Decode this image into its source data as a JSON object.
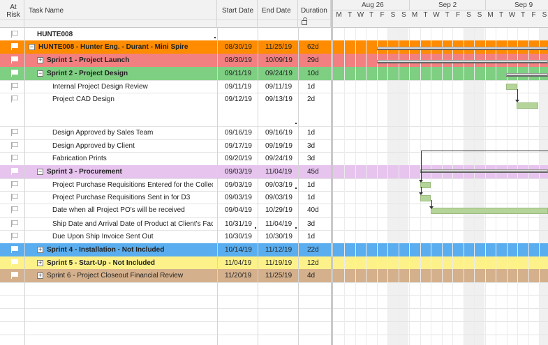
{
  "columns": {
    "at_risk": "At Risk",
    "task_name": "Task Name",
    "start_date": "Start Date",
    "end_date": "End Date",
    "duration": "Duration"
  },
  "timeline": {
    "weeks": [
      "Aug 26",
      "Sep 2",
      "Sep 9"
    ],
    "days": [
      "M",
      "T",
      "W",
      "T",
      "F",
      "S",
      "S",
      "M",
      "T",
      "W",
      "T",
      "F",
      "S",
      "S",
      "M",
      "T",
      "W",
      "T",
      "F",
      "S"
    ]
  },
  "rows": [
    {
      "name": "HUNTE008",
      "start": "",
      "end": "",
      "duration": "",
      "bold": true
    },
    {
      "name": "HUNTE008 - Hunter Eng. - Durant - Mini Spire",
      "start": "08/30/19",
      "end": "11/25/19",
      "duration": "62d",
      "bold": true,
      "toggle": "−",
      "color": "#ff8c00"
    },
    {
      "name": "Sprint 1 - Project Launch",
      "start": "08/30/19",
      "end": "10/09/19",
      "duration": "29d",
      "bold": true,
      "toggle": "+",
      "color": "#f28080"
    },
    {
      "name": "Sprint 2 - Project Design",
      "start": "09/11/19",
      "end": "09/24/19",
      "duration": "10d",
      "bold": true,
      "toggle": "−",
      "color": "#7ecf82"
    },
    {
      "name": "Internal Project Design Review",
      "start": "09/11/19",
      "end": "09/11/19",
      "duration": "1d"
    },
    {
      "name": "Project CAD Design",
      "start": "09/12/19",
      "end": "09/13/19",
      "duration": "2d"
    },
    {
      "name": "Design Approved by Sales Team",
      "start": "09/16/19",
      "end": "09/16/19",
      "duration": "1d"
    },
    {
      "name": "Design Approved by Client",
      "start": "09/17/19",
      "end": "09/19/19",
      "duration": "3d"
    },
    {
      "name": "Fabrication Prints",
      "start": "09/20/19",
      "end": "09/24/19",
      "duration": "3d"
    },
    {
      "name": "Sprint 3 - Procurement",
      "start": "09/03/19",
      "end": "11/04/19",
      "duration": "45d",
      "bold": true,
      "toggle": "−",
      "color": "#e6c4ee"
    },
    {
      "name": "Project Purchase Requisitions Entered for the Collector",
      "start": "09/03/19",
      "end": "09/03/19",
      "duration": "1d"
    },
    {
      "name": "Project Purchase Requisitions Sent in for D3",
      "start": "09/03/19",
      "end": "09/03/19",
      "duration": "1d"
    },
    {
      "name": "Date when all Project PO's will be received",
      "start": "09/04/19",
      "end": "10/29/19",
      "duration": "40d"
    },
    {
      "name": "Ship Date and Arrival Date of Product at Client's Facility",
      "start": "10/31/19",
      "end": "11/04/19",
      "duration": "3d"
    },
    {
      "name": "Due Upon Ship Invoice Sent Out",
      "start": "10/30/19",
      "end": "10/30/19",
      "duration": "1d"
    },
    {
      "name": "Sprint 4 - Installation - Not Included",
      "start": "10/14/19",
      "end": "11/12/19",
      "duration": "22d",
      "bold": true,
      "toggle": "+",
      "color": "#5aaef0"
    },
    {
      "name": "Sprint 5 - Start-Up - Not Included",
      "start": "11/04/19",
      "end": "11/19/19",
      "duration": "12d",
      "bold": true,
      "toggle": "+",
      "color": "#fdf28a"
    },
    {
      "name": "Sprint 6 - Project Closeout Financial Review",
      "start": "11/20/19",
      "end": "11/25/19",
      "duration": "4d",
      "toggle": "+",
      "color": "#d4b08c"
    }
  ]
}
